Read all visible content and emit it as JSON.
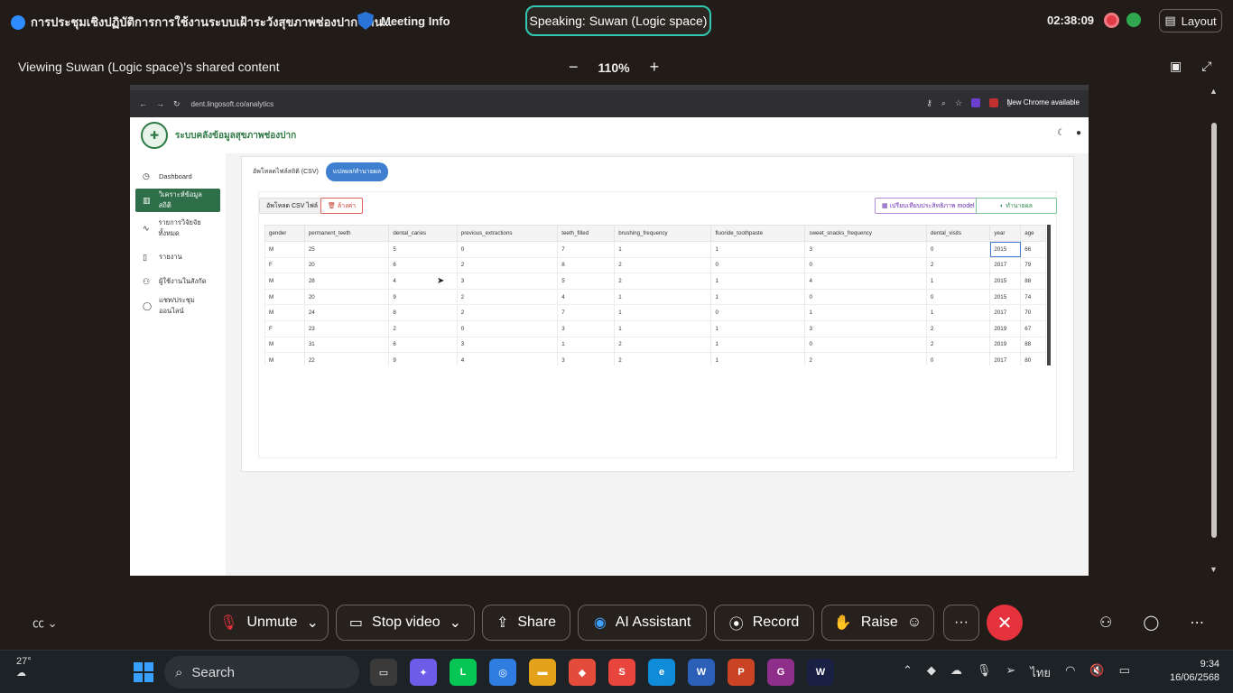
{
  "top": {
    "meeting_title": "การประชุมเชิงปฏิบัติการการใช้งานระบบเฝ้าระวังสุขภาพช่องปาก ผ่าน...",
    "meeting_info": "Meeting Info",
    "speaking": "Speaking: Suwan (Logic space)",
    "clock": "02:38:09",
    "layout": "Layout"
  },
  "view": {
    "viewing": "Viewing Suwan (Logic space)'s shared content",
    "zoom_out": "−",
    "zoom": "110%",
    "zoom_in": "+"
  },
  "browser": {
    "url": "dent.lingosoft.co/analytics",
    "new_chrome": "New Chrome available"
  },
  "app": {
    "name": "ระบบคลังข้อมูลสุขภาพช่องปาก",
    "nav": [
      {
        "label": "Dashboard",
        "icon": "clock-icon"
      },
      {
        "label": "วิเคราะห์ข้อมูลสถิติ",
        "icon": "chart-icon"
      },
      {
        "label": "รายการวิจัยจัยทั้งหมด",
        "icon": "activity-icon"
      },
      {
        "label": "รายงาน",
        "icon": "file-icon"
      },
      {
        "label": "ผู้ใช้งานในสังกัด",
        "icon": "users-icon"
      },
      {
        "label": "แชท/ประชุมออนไลน์",
        "icon": "chat-icon"
      }
    ],
    "tabs": {
      "csv": "อัพโหลดไฟล์สถิติ (CSV)",
      "predict": "แปลผล/ทำนายผล"
    },
    "buttons": {
      "upload": "อัพโหลด CSV ไฟล์",
      "clear": "ล้างค่า",
      "compare": "เปรียบเทียบประสิทธิภาพ model",
      "predict": "ทำนายผล"
    },
    "table": {
      "headers": [
        "gender",
        "permanent_teeth",
        "dental_caries",
        "previous_extractions",
        "teeth_filled",
        "brushing_frequency",
        "fluoride_toothpaste",
        "sweet_snacks_frequency",
        "dental_visits",
        "year",
        "age"
      ],
      "rows": [
        [
          "M",
          "25",
          "5",
          "0",
          "7",
          "1",
          "1",
          "3",
          "0",
          "2015",
          "66"
        ],
        [
          "F",
          "20",
          "6",
          "2",
          "8",
          "2",
          "0",
          "0",
          "2",
          "2017",
          "79"
        ],
        [
          "M",
          "28",
          "4",
          "3",
          "5",
          "2",
          "1",
          "4",
          "1",
          "2015",
          "88"
        ],
        [
          "M",
          "20",
          "9",
          "2",
          "4",
          "1",
          "1",
          "0",
          "0",
          "2015",
          "74"
        ],
        [
          "M",
          "24",
          "8",
          "2",
          "7",
          "1",
          "0",
          "1",
          "1",
          "2017",
          "70"
        ],
        [
          "F",
          "23",
          "2",
          "0",
          "3",
          "1",
          "1",
          "3",
          "2",
          "2019",
          "67"
        ],
        [
          "M",
          "31",
          "6",
          "3",
          "1",
          "2",
          "1",
          "0",
          "2",
          "2019",
          "88"
        ],
        [
          "M",
          "22",
          "9",
          "4",
          "3",
          "2",
          "1",
          "2",
          "0",
          "2017",
          "80"
        ]
      ]
    }
  },
  "controls": {
    "unmute": "Unmute",
    "stop_video": "Stop video",
    "share": "Share",
    "ai": "AI Assistant",
    "record": "Record",
    "raise": "Raise"
  },
  "taskbar": {
    "temp": "27°",
    "search": "Search",
    "lang": "ไทย",
    "time": "9:34",
    "date": "16/06/2568"
  },
  "colors": {
    "accent_teal": "#30c9b0",
    "app_green": "#2e6e48",
    "end_call": "#e5323c"
  }
}
